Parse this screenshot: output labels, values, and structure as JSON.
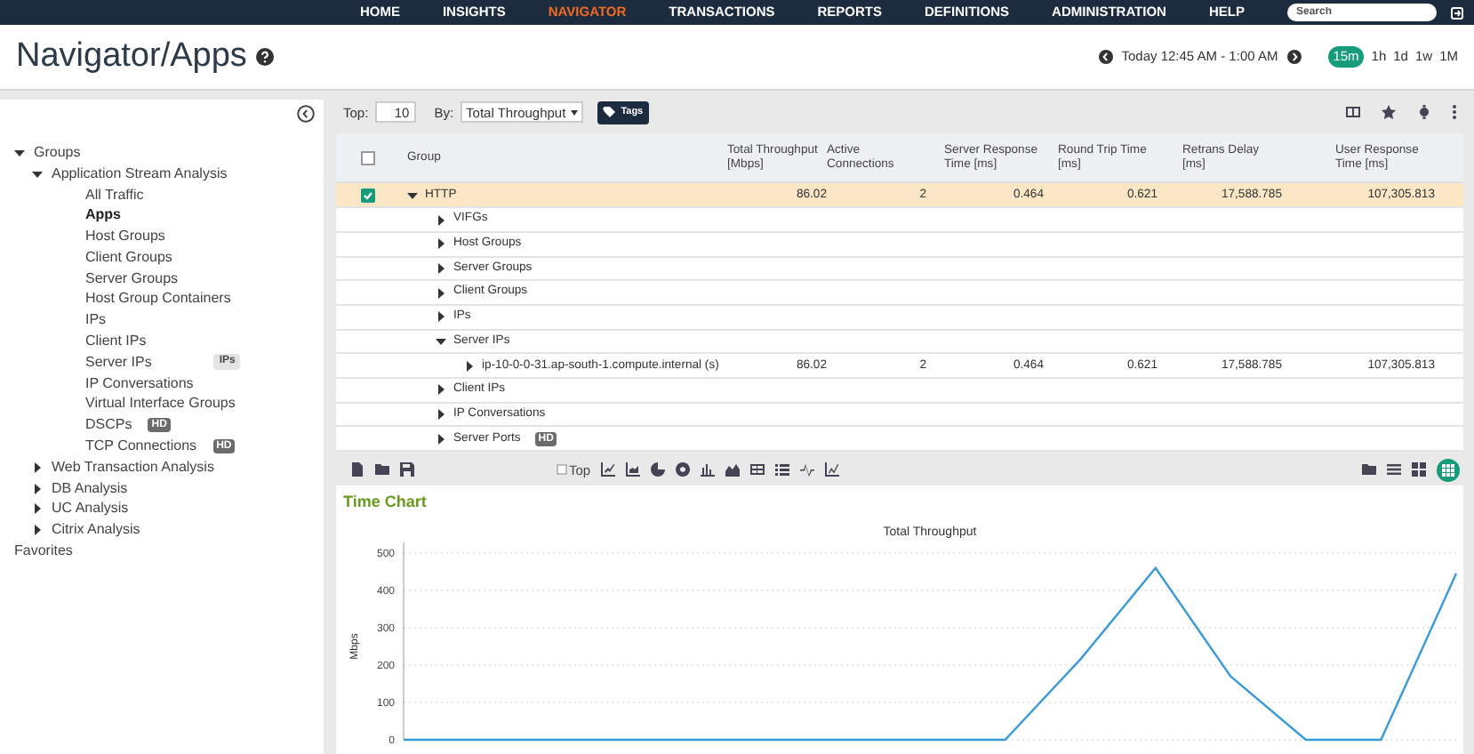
{
  "nav": {
    "items": [
      {
        "label": "HOME",
        "selected": false
      },
      {
        "label": "INSIGHTS",
        "selected": false
      },
      {
        "label": "NAVIGATOR",
        "selected": true
      },
      {
        "label": "TRANSACTIONS",
        "selected": false
      },
      {
        "label": "REPORTS",
        "selected": false
      },
      {
        "label": "DEFINITIONS",
        "selected": false
      },
      {
        "label": "ADMINISTRATION",
        "selected": false
      },
      {
        "label": "HELP",
        "selected": false
      }
    ],
    "search": {
      "placeholder": "Search"
    }
  },
  "header": {
    "title": "Navigator/Apps",
    "time_range": "Today 12:45 AM - 1:00 AM",
    "ranges": [
      {
        "label": "15m",
        "selected": true
      },
      {
        "label": "1h",
        "selected": false
      },
      {
        "label": "1d",
        "selected": false
      },
      {
        "label": "1w",
        "selected": false
      },
      {
        "label": "1M",
        "selected": false
      }
    ]
  },
  "sidebar": {
    "items": [
      {
        "label": "Groups",
        "expanded": true,
        "children": [
          {
            "label": "Application Stream Analysis",
            "expanded": true,
            "children": [
              {
                "label": "All Traffic",
                "selected": false
              },
              {
                "label": "Apps",
                "selected": true
              },
              {
                "label": "Host Groups",
                "selected": false
              },
              {
                "label": "Client Groups",
                "selected": false
              },
              {
                "label": "Server Groups",
                "selected": false
              },
              {
                "label": "Host Group Containers",
                "selected": false
              },
              {
                "label": "IPs",
                "selected": false
              },
              {
                "label": "Client IPs",
                "selected": false
              },
              {
                "label": "Server IPs",
                "selected": false,
                "tag": "IPs"
              },
              {
                "label": "IP Conversations",
                "selected": false
              },
              {
                "label": "Virtual Interface Groups",
                "selected": false
              },
              {
                "label": "DSCPs",
                "selected": false,
                "badge": "HD"
              },
              {
                "label": "TCP Connections",
                "selected": false,
                "badge": "HD"
              }
            ]
          },
          {
            "label": "Web Transaction Analysis",
            "expanded": false
          },
          {
            "label": "DB Analysis",
            "expanded": false
          },
          {
            "label": "UC Analysis",
            "expanded": false
          },
          {
            "label": "Citrix Analysis",
            "expanded": false
          }
        ]
      },
      {
        "label": "Favorites"
      }
    ]
  },
  "toolbar": {
    "top_label": "Top:",
    "top_value": "10",
    "by_label": "By:",
    "by_value": "Total Throughput",
    "tags_button": "Tags"
  },
  "table": {
    "header_checked": false,
    "columns": [
      "Group",
      "Total Throughput [Mbps]",
      "Active Connections",
      "Server Response Time [ms]",
      "Round Trip Time [ms]",
      "Retrans Delay [ms]",
      "User Response Time [ms]"
    ],
    "rows": [
      {
        "group": "HTTP",
        "checked": true,
        "expanded": true,
        "values": [
          "86.02",
          "2",
          "0.464",
          "0.621",
          "17,588.785",
          "107,305.813"
        ],
        "children": [
          {
            "group": "VIFGs",
            "expanded": false
          },
          {
            "group": "Host Groups",
            "expanded": false
          },
          {
            "group": "Server Groups",
            "expanded": false
          },
          {
            "group": "Client Groups",
            "expanded": false
          },
          {
            "group": "IPs",
            "expanded": false
          },
          {
            "group": "Server IPs",
            "expanded": true,
            "children": [
              {
                "group": "ip-10-0-0-31.ap-south-1.compute.internal (s)",
                "expanded": false,
                "values": [
                  "86.02",
                  "2",
                  "0.464",
                  "0.621",
                  "17,588.785",
                  "107,305.813"
                ]
              }
            ]
          },
          {
            "group": "Client IPs",
            "expanded": false
          },
          {
            "group": "IP Conversations",
            "expanded": false
          },
          {
            "group": "Server Ports",
            "expanded": false,
            "badge": "HD"
          }
        ]
      }
    ]
  },
  "chart_toolbar": {
    "top_label": "Top",
    "top_checked": false
  },
  "time_chart": {
    "heading": "Time Chart",
    "chart_data": {
      "type": "line",
      "title": "Total Throughput",
      "ylabel": "Mbps",
      "ylim": [
        0,
        500
      ],
      "yticks": [
        0,
        100,
        200,
        300,
        400,
        500
      ],
      "grid": true,
      "series": [
        {
          "color": "#3a9ad9",
          "values": [
            0,
            0,
            0,
            0,
            0,
            0,
            0,
            0,
            0,
            215,
            460,
            170,
            0,
            0,
            445
          ]
        }
      ]
    }
  }
}
